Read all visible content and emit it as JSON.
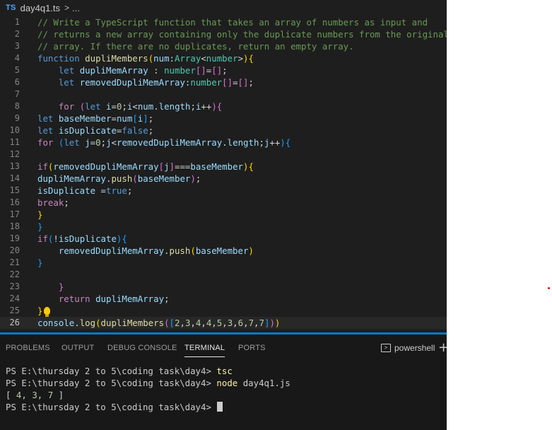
{
  "breadcrumb": {
    "badge": "TS",
    "file": "day4q1.ts",
    "separator": ">",
    "more": "..."
  },
  "editor": {
    "current_line": 26,
    "lines": [
      {
        "n": "1",
        "tokens": [
          {
            "t": "// Write a TypeScript function that takes an array of numbers as input and",
            "c": "comment"
          }
        ]
      },
      {
        "n": "2",
        "tokens": [
          {
            "t": "// returns a new array containing only the duplicate numbers from the original",
            "c": "comment"
          }
        ]
      },
      {
        "n": "3",
        "tokens": [
          {
            "t": "// array. If there are no duplicates, return an empty array.",
            "c": "comment"
          }
        ]
      },
      {
        "n": "4",
        "tokens": [
          {
            "t": "function",
            "c": "keyword"
          },
          {
            "t": " ",
            "c": "plain"
          },
          {
            "t": "dupliMembers",
            "c": "func"
          },
          {
            "t": "(",
            "c": "b1"
          },
          {
            "t": "num",
            "c": "var"
          },
          {
            "t": ":",
            "c": "plain"
          },
          {
            "t": "Array",
            "c": "type"
          },
          {
            "t": "<",
            "c": "plain"
          },
          {
            "t": "number",
            "c": "type"
          },
          {
            "t": ">",
            "c": "plain"
          },
          {
            "t": ")",
            "c": "b1"
          },
          {
            "t": "{",
            "c": "b1"
          }
        ]
      },
      {
        "n": "5",
        "tokens": [
          {
            "t": "    ",
            "c": "plain"
          },
          {
            "t": "let",
            "c": "keyword"
          },
          {
            "t": " ",
            "c": "plain"
          },
          {
            "t": "dupliMemArray",
            "c": "var"
          },
          {
            "t": " : ",
            "c": "plain"
          },
          {
            "t": "number",
            "c": "type"
          },
          {
            "t": "[]",
            "c": "b2"
          },
          {
            "t": "=",
            "c": "plain"
          },
          {
            "t": "[]",
            "c": "b2"
          },
          {
            "t": ";",
            "c": "plain"
          }
        ]
      },
      {
        "n": "6",
        "tokens": [
          {
            "t": "    ",
            "c": "plain"
          },
          {
            "t": "let",
            "c": "keyword"
          },
          {
            "t": " ",
            "c": "plain"
          },
          {
            "t": "removedDupliMemArray",
            "c": "var"
          },
          {
            "t": ":",
            "c": "plain"
          },
          {
            "t": "number",
            "c": "type"
          },
          {
            "t": "[]",
            "c": "b2"
          },
          {
            "t": "=",
            "c": "plain"
          },
          {
            "t": "[]",
            "c": "b2"
          },
          {
            "t": ";",
            "c": "plain"
          }
        ]
      },
      {
        "n": "7",
        "tokens": []
      },
      {
        "n": "8",
        "tokens": [
          {
            "t": "    ",
            "c": "plain"
          },
          {
            "t": "for",
            "c": "control"
          },
          {
            "t": " ",
            "c": "plain"
          },
          {
            "t": "(",
            "c": "b2"
          },
          {
            "t": "let",
            "c": "keyword"
          },
          {
            "t": " ",
            "c": "plain"
          },
          {
            "t": "i",
            "c": "var"
          },
          {
            "t": "=",
            "c": "plain"
          },
          {
            "t": "0",
            "c": "num"
          },
          {
            "t": ";",
            "c": "plain"
          },
          {
            "t": "i",
            "c": "var"
          },
          {
            "t": "<",
            "c": "plain"
          },
          {
            "t": "num",
            "c": "var"
          },
          {
            "t": ".",
            "c": "plain"
          },
          {
            "t": "length",
            "c": "var"
          },
          {
            "t": ";",
            "c": "plain"
          },
          {
            "t": "i",
            "c": "var"
          },
          {
            "t": "++",
            "c": "plain"
          },
          {
            "t": ")",
            "c": "b2"
          },
          {
            "t": "{",
            "c": "b2"
          }
        ]
      },
      {
        "n": "9",
        "tokens": [
          {
            "t": "let",
            "c": "keyword"
          },
          {
            "t": " ",
            "c": "plain"
          },
          {
            "t": "baseMember",
            "c": "var"
          },
          {
            "t": "=",
            "c": "plain"
          },
          {
            "t": "num",
            "c": "var"
          },
          {
            "t": "[",
            "c": "b3"
          },
          {
            "t": "i",
            "c": "var"
          },
          {
            "t": "]",
            "c": "b3"
          },
          {
            "t": ";",
            "c": "plain"
          }
        ]
      },
      {
        "n": "10",
        "tokens": [
          {
            "t": "let",
            "c": "keyword"
          },
          {
            "t": " ",
            "c": "plain"
          },
          {
            "t": "isDuplicate",
            "c": "var"
          },
          {
            "t": "=",
            "c": "plain"
          },
          {
            "t": "false",
            "c": "keyword"
          },
          {
            "t": ";",
            "c": "plain"
          }
        ]
      },
      {
        "n": "11",
        "tokens": [
          {
            "t": "for",
            "c": "control"
          },
          {
            "t": " ",
            "c": "plain"
          },
          {
            "t": "(",
            "c": "b3"
          },
          {
            "t": "let",
            "c": "keyword"
          },
          {
            "t": " ",
            "c": "plain"
          },
          {
            "t": "j",
            "c": "var"
          },
          {
            "t": "=",
            "c": "plain"
          },
          {
            "t": "0",
            "c": "num"
          },
          {
            "t": ";",
            "c": "plain"
          },
          {
            "t": "j",
            "c": "var"
          },
          {
            "t": "<",
            "c": "plain"
          },
          {
            "t": "removedDupliMemArray",
            "c": "var"
          },
          {
            "t": ".",
            "c": "plain"
          },
          {
            "t": "length",
            "c": "var"
          },
          {
            "t": ";",
            "c": "plain"
          },
          {
            "t": "j",
            "c": "var"
          },
          {
            "t": "++",
            "c": "plain"
          },
          {
            "t": ")",
            "c": "b3"
          },
          {
            "t": "{",
            "c": "b3"
          }
        ]
      },
      {
        "n": "12",
        "tokens": []
      },
      {
        "n": "13",
        "tokens": [
          {
            "t": "if",
            "c": "control"
          },
          {
            "t": "(",
            "c": "b1"
          },
          {
            "t": "removedDupliMemArray",
            "c": "var"
          },
          {
            "t": "[",
            "c": "b2"
          },
          {
            "t": "j",
            "c": "var"
          },
          {
            "t": "]",
            "c": "b2"
          },
          {
            "t": "===",
            "c": "plain"
          },
          {
            "t": "baseMember",
            "c": "var"
          },
          {
            "t": ")",
            "c": "b1"
          },
          {
            "t": "{",
            "c": "b1"
          }
        ]
      },
      {
        "n": "14",
        "tokens": [
          {
            "t": "dupliMemArray",
            "c": "var"
          },
          {
            "t": ".",
            "c": "plain"
          },
          {
            "t": "push",
            "c": "func"
          },
          {
            "t": "(",
            "c": "b2"
          },
          {
            "t": "baseMember",
            "c": "var"
          },
          {
            "t": ")",
            "c": "b2"
          },
          {
            "t": ";",
            "c": "plain"
          }
        ]
      },
      {
        "n": "15",
        "tokens": [
          {
            "t": "isDuplicate",
            "c": "var"
          },
          {
            "t": " =",
            "c": "plain"
          },
          {
            "t": "true",
            "c": "keyword"
          },
          {
            "t": ";",
            "c": "plain"
          }
        ]
      },
      {
        "n": "16",
        "tokens": [
          {
            "t": "break",
            "c": "control"
          },
          {
            "t": ";",
            "c": "plain"
          }
        ]
      },
      {
        "n": "17",
        "tokens": [
          {
            "t": "}",
            "c": "b1"
          }
        ]
      },
      {
        "n": "18",
        "tokens": [
          {
            "t": "}",
            "c": "b3"
          }
        ]
      },
      {
        "n": "19",
        "tokens": [
          {
            "t": "if",
            "c": "control"
          },
          {
            "t": "(",
            "c": "b3"
          },
          {
            "t": "!",
            "c": "plain"
          },
          {
            "t": "isDuplicate",
            "c": "var"
          },
          {
            "t": ")",
            "c": "b3"
          },
          {
            "t": "{",
            "c": "b3"
          }
        ]
      },
      {
        "n": "20",
        "tokens": [
          {
            "t": "    ",
            "c": "plain"
          },
          {
            "t": "removedDupliMemArray",
            "c": "var"
          },
          {
            "t": ".",
            "c": "plain"
          },
          {
            "t": "push",
            "c": "func"
          },
          {
            "t": "(",
            "c": "b1"
          },
          {
            "t": "baseMember",
            "c": "var"
          },
          {
            "t": ")",
            "c": "b1"
          }
        ]
      },
      {
        "n": "21",
        "tokens": [
          {
            "t": "}",
            "c": "b3"
          }
        ]
      },
      {
        "n": "22",
        "tokens": []
      },
      {
        "n": "23",
        "tokens": [
          {
            "t": "    ",
            "c": "plain"
          },
          {
            "t": "}",
            "c": "b2"
          }
        ]
      },
      {
        "n": "24",
        "tokens": [
          {
            "t": "    ",
            "c": "plain"
          },
          {
            "t": "return",
            "c": "control"
          },
          {
            "t": " ",
            "c": "plain"
          },
          {
            "t": "dupliMemArray",
            "c": "var"
          },
          {
            "t": ";",
            "c": "plain"
          }
        ]
      },
      {
        "n": "25",
        "tokens": [
          {
            "t": "}",
            "c": "b1"
          }
        ],
        "bulb": true
      },
      {
        "n": "26",
        "tokens": [
          {
            "t": "console",
            "c": "var"
          },
          {
            "t": ".",
            "c": "plain"
          },
          {
            "t": "log",
            "c": "func"
          },
          {
            "t": "(",
            "c": "b1"
          },
          {
            "t": "dupliMembers",
            "c": "func"
          },
          {
            "t": "(",
            "c": "b2"
          },
          {
            "t": "[",
            "c": "b3"
          },
          {
            "t": "2",
            "c": "num"
          },
          {
            "t": ",",
            "c": "plain"
          },
          {
            "t": "3",
            "c": "num"
          },
          {
            "t": ",",
            "c": "plain"
          },
          {
            "t": "4",
            "c": "num"
          },
          {
            "t": ",",
            "c": "plain"
          },
          {
            "t": "4",
            "c": "num"
          },
          {
            "t": ",",
            "c": "plain"
          },
          {
            "t": "5",
            "c": "num"
          },
          {
            "t": ",",
            "c": "plain"
          },
          {
            "t": "3",
            "c": "num"
          },
          {
            "t": ",",
            "c": "plain"
          },
          {
            "t": "6",
            "c": "num"
          },
          {
            "t": ",",
            "c": "plain"
          },
          {
            "t": "7",
            "c": "num"
          },
          {
            "t": ",",
            "c": "plain"
          },
          {
            "t": "7",
            "c": "num"
          },
          {
            "t": "]",
            "c": "b3"
          },
          {
            "t": ")",
            "c": "b2"
          },
          {
            "t": ")",
            "c": "b1"
          }
        ]
      }
    ]
  },
  "panel": {
    "tabs": [
      {
        "label": "PROBLEMS",
        "active": false
      },
      {
        "label": "OUTPUT",
        "active": false
      },
      {
        "label": "DEBUG CONSOLE",
        "active": false
      },
      {
        "label": "TERMINAL",
        "active": true
      },
      {
        "label": "PORTS",
        "active": false
      }
    ],
    "shell_label": "powershell",
    "plus": "+"
  },
  "terminal": {
    "lines": [
      {
        "prompt": "PS E:\\thursday 2 to 5\\coding task\\day4> ",
        "cmd": "tsc",
        "arg": ""
      },
      {
        "prompt": "PS E:\\thursday 2 to 5\\coding task\\day4> ",
        "cmd": "node",
        "arg": " day4q1.js"
      },
      {
        "output": [
          {
            "t": "[ ",
            "c": "bracket"
          },
          {
            "t": "4",
            "c": "out-num"
          },
          {
            "t": ", ",
            "c": "bracket"
          },
          {
            "t": "3",
            "c": "out-num"
          },
          {
            "t": ", ",
            "c": "bracket"
          },
          {
            "t": "7",
            "c": "out-num"
          },
          {
            "t": " ]",
            "c": "bracket"
          }
        ]
      },
      {
        "prompt": "PS E:\\thursday 2 to 5\\coding task\\day4> ",
        "cmd": "",
        "arg": "",
        "cursor": true
      }
    ]
  },
  "colors": {
    "editor_bg": "#1e1e1e",
    "panel_bg": "#181818",
    "accent": "#007acc"
  }
}
